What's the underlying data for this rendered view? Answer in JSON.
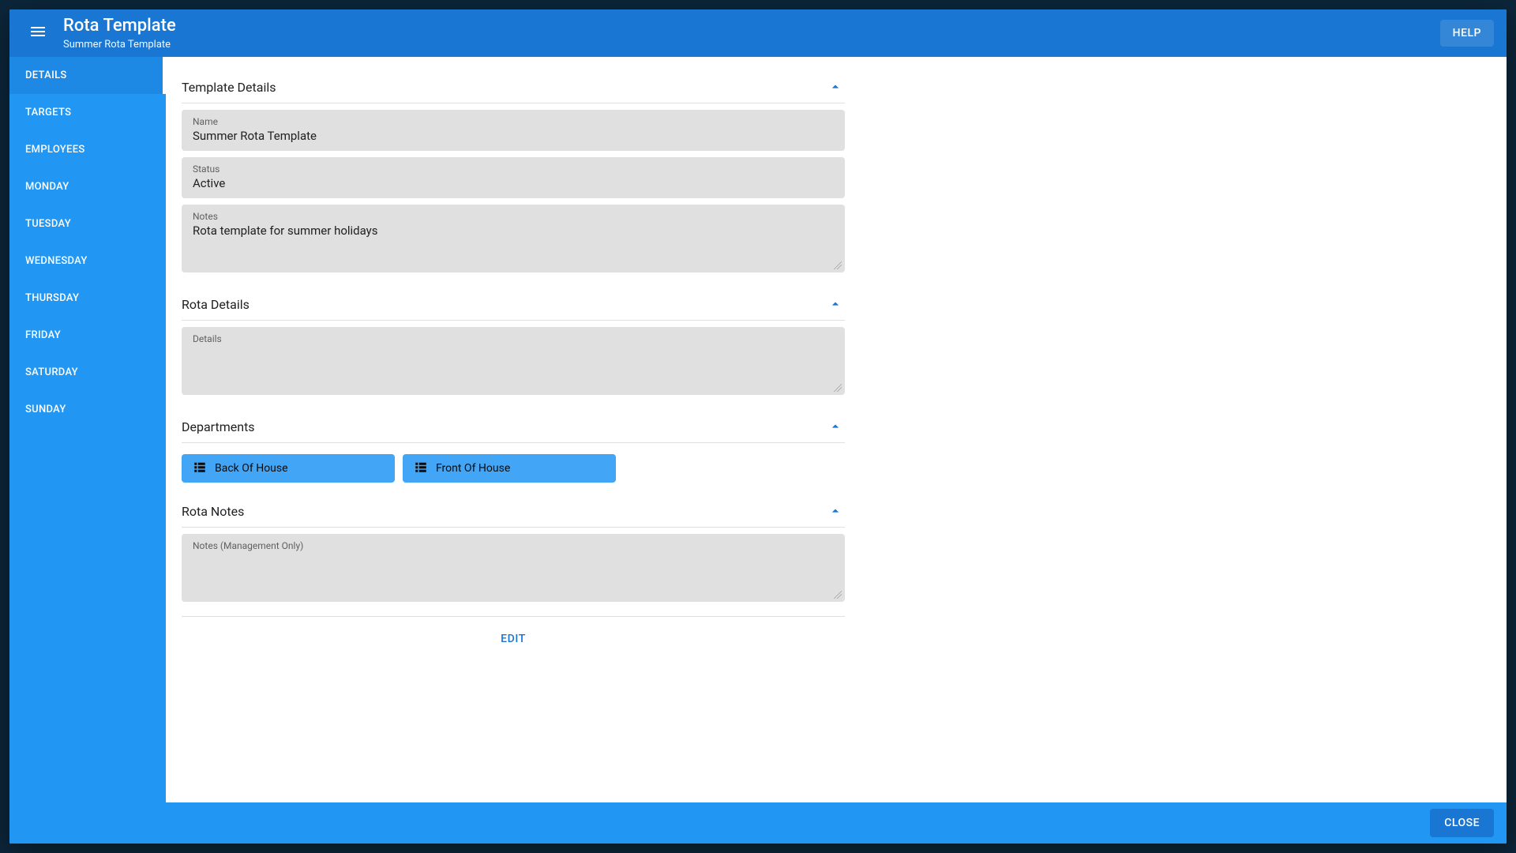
{
  "header": {
    "title": "Rota Template",
    "subtitle": "Summer Rota Template",
    "help_label": "HELP"
  },
  "sidebar": {
    "items": [
      {
        "label": "DETAILS",
        "active": true
      },
      {
        "label": "TARGETS",
        "active": false
      },
      {
        "label": "EMPLOYEES",
        "active": false
      },
      {
        "label": "MONDAY",
        "active": false
      },
      {
        "label": "TUESDAY",
        "active": false
      },
      {
        "label": "WEDNESDAY",
        "active": false
      },
      {
        "label": "THURSDAY",
        "active": false
      },
      {
        "label": "FRIDAY",
        "active": false
      },
      {
        "label": "SATURDAY",
        "active": false
      },
      {
        "label": "SUNDAY",
        "active": false
      }
    ]
  },
  "sections": {
    "template_details": {
      "title": "Template Details",
      "fields": {
        "name": {
          "label": "Name",
          "value": "Summer Rota Template"
        },
        "status": {
          "label": "Status",
          "value": "Active"
        },
        "notes": {
          "label": "Notes",
          "value": "Rota template for summer holidays"
        }
      }
    },
    "rota_details": {
      "title": "Rota Details",
      "details": {
        "label": "Details",
        "value": ""
      }
    },
    "departments": {
      "title": "Departments",
      "chips": [
        {
          "label": "Back Of House"
        },
        {
          "label": "Front Of House"
        }
      ]
    },
    "rota_notes": {
      "title": "Rota Notes",
      "notes_mgmt": {
        "label": "Notes (Management Only)",
        "value": ""
      }
    }
  },
  "actions": {
    "edit_label": "EDIT"
  },
  "footer": {
    "close_label": "CLOSE"
  }
}
